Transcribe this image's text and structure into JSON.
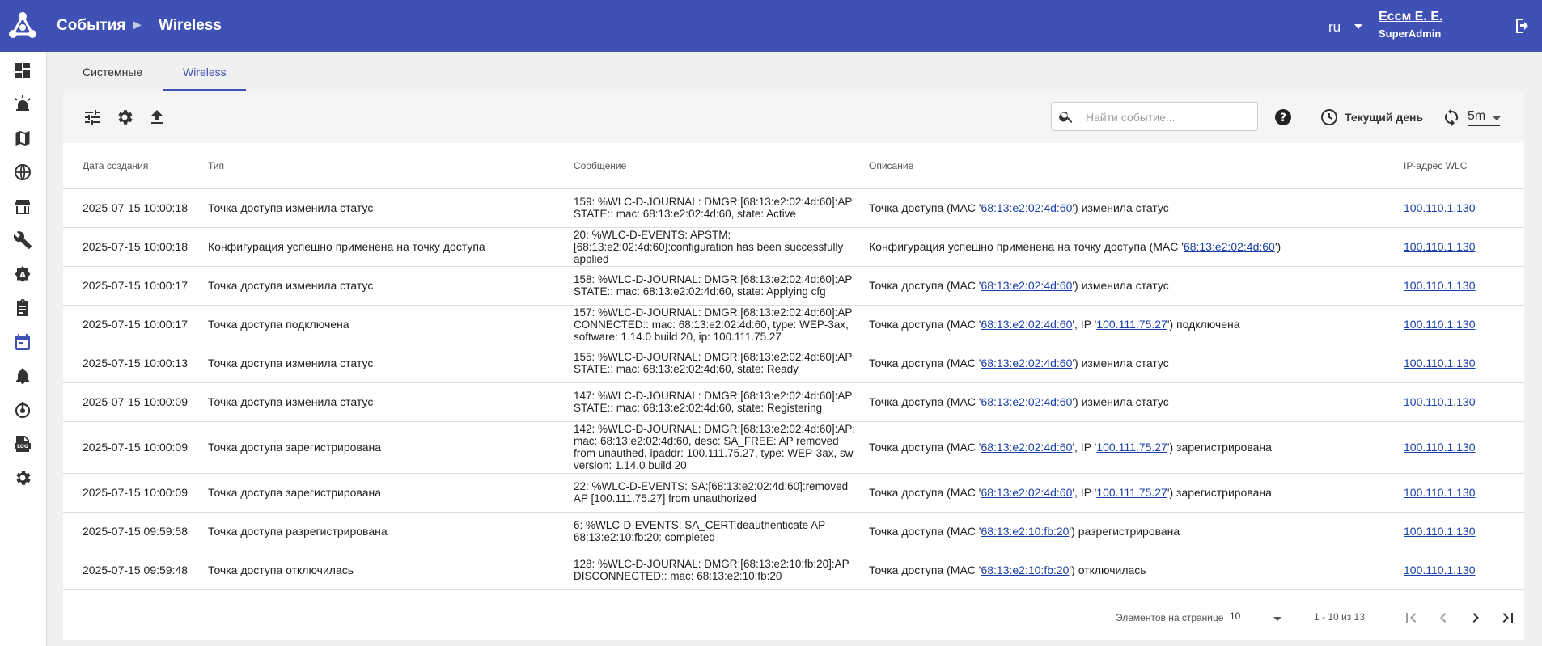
{
  "header": {
    "breadcrumb_root": "События",
    "breadcrumb_current": "Wireless",
    "language": "ru",
    "user_name": "Ессм Е. Е.",
    "user_role": "SuperAdmin"
  },
  "sidebar": {
    "items": [
      {
        "name": "dashboard",
        "icon": "dashboard-icon"
      },
      {
        "name": "alarms",
        "icon": "siren-icon"
      },
      {
        "name": "maps",
        "icon": "map-icon"
      },
      {
        "name": "network",
        "icon": "globe-icon"
      },
      {
        "name": "inventory",
        "icon": "store-icon"
      },
      {
        "name": "tools",
        "icon": "wrench-icon"
      },
      {
        "name": "auto-config",
        "icon": "gear-a-icon"
      },
      {
        "name": "tasks",
        "icon": "clipboard-icon"
      },
      {
        "name": "events",
        "icon": "calendar-icon",
        "active": true
      },
      {
        "name": "notifications",
        "icon": "bell-icon"
      },
      {
        "name": "monitoring",
        "icon": "power-icon"
      },
      {
        "name": "logs",
        "icon": "log-icon"
      },
      {
        "name": "settings",
        "icon": "settings-icon"
      }
    ]
  },
  "tabs": [
    {
      "label": "Системные",
      "active": false
    },
    {
      "label": "Wireless",
      "active": true
    }
  ],
  "toolbar": {
    "search_placeholder": "Найти событие...",
    "period": "Текущий день",
    "refresh_interval": "5m"
  },
  "table": {
    "columns": {
      "date": "Дата создания",
      "type": "Тип",
      "message": "Сообщение",
      "description": "Описание",
      "ip": "IP-адрес WLC"
    },
    "rows": [
      {
        "date": "2025-07-15 10:00:18",
        "type": "Точка доступа изменила статус",
        "message": "159: %WLC-D-JOURNAL: DMGR:[68:13:e2:02:4d:60]:AP STATE:: mac: 68:13:e2:02:4d:60, state: Active",
        "desc": {
          "pre": "Точка доступа (MAC '",
          "mac": "68:13:e2:02:4d:60",
          "mid": "",
          "ip": "",
          "post": "') изменила статус"
        },
        "ip": "100.110.1.130"
      },
      {
        "date": "2025-07-15 10:00:18",
        "type": "Конфигурация успешно применена на точку доступа",
        "message": "20: %WLC-D-EVENTS: APSTM: [68:13:e2:02:4d:60]:configuration has been successfully applied",
        "desc": {
          "pre": "Конфигурация успешно применена на точку доступа (MAC '",
          "mac": "68:13:e2:02:4d:60",
          "mid": "",
          "ip": "",
          "post": "')"
        },
        "ip": "100.110.1.130"
      },
      {
        "date": "2025-07-15 10:00:17",
        "type": "Точка доступа изменила статус",
        "message": "158: %WLC-D-JOURNAL: DMGR:[68:13:e2:02:4d:60]:AP STATE:: mac: 68:13:e2:02:4d:60, state: Applying cfg",
        "desc": {
          "pre": "Точка доступа (MAC '",
          "mac": "68:13:e2:02:4d:60",
          "mid": "",
          "ip": "",
          "post": "') изменила статус"
        },
        "ip": "100.110.1.130"
      },
      {
        "date": "2025-07-15 10:00:17",
        "type": "Точка доступа подключена",
        "message": "157: %WLC-D-JOURNAL: DMGR:[68:13:e2:02:4d:60]:AP CONNECTED:: mac: 68:13:e2:02:4d:60, type: WEP-3ax, software: 1.14.0 build 20, ip: 100.111.75.27",
        "desc": {
          "pre": "Точка доступа (MAC '",
          "mac": "68:13:e2:02:4d:60",
          "mid": "', IP '",
          "ip": "100.111.75.27",
          "post": "') подключена"
        },
        "ip": "100.110.1.130"
      },
      {
        "date": "2025-07-15 10:00:13",
        "type": "Точка доступа изменила статус",
        "message": "155: %WLC-D-JOURNAL: DMGR:[68:13:e2:02:4d:60]:AP STATE:: mac: 68:13:e2:02:4d:60, state: Ready",
        "desc": {
          "pre": "Точка доступа (MAC '",
          "mac": "68:13:e2:02:4d:60",
          "mid": "",
          "ip": "",
          "post": "') изменила статус"
        },
        "ip": "100.110.1.130"
      },
      {
        "date": "2025-07-15 10:00:09",
        "type": "Точка доступа изменила статус",
        "message": "147: %WLC-D-JOURNAL: DMGR:[68:13:e2:02:4d:60]:AP STATE:: mac: 68:13:e2:02:4d:60, state: Registering",
        "desc": {
          "pre": "Точка доступа (MAC '",
          "mac": "68:13:e2:02:4d:60",
          "mid": "",
          "ip": "",
          "post": "') изменила статус"
        },
        "ip": "100.110.1.130"
      },
      {
        "date": "2025-07-15 10:00:09",
        "type": "Точка доступа зарегистрирована",
        "message": "142: %WLC-D-JOURNAL: DMGR:[68:13:e2:02:4d:60]:AP: mac: 68:13:e2:02:4d:60, desc: SA_FREE: AP removed from unauthed, ipaddr: 100.111.75.27, type: WEP-3ax, sw version: 1.14.0 build 20",
        "desc": {
          "pre": "Точка доступа (MAC '",
          "mac": "68:13:e2:02:4d:60",
          "mid": "', IP '",
          "ip": "100.111.75.27",
          "post": "') зарегистрирована"
        },
        "ip": "100.110.1.130",
        "tall": true
      },
      {
        "date": "2025-07-15 10:00:09",
        "type": "Точка доступа зарегистрирована",
        "message": "22: %WLC-D-EVENTS: SA:[68:13:e2:02:4d:60]:removed AP [100.111.75.27] from unauthorized",
        "desc": {
          "pre": "Точка доступа (MAC '",
          "mac": "68:13:e2:02:4d:60",
          "mid": "', IP '",
          "ip": "100.111.75.27",
          "post": "') зарегистрирована"
        },
        "ip": "100.110.1.130"
      },
      {
        "date": "2025-07-15 09:59:58",
        "type": "Точка доступа разрегистрирована",
        "message": "6: %WLC-D-EVENTS: SA_CERT:deauthenticate AP 68:13:e2:10:fb:20: completed",
        "desc": {
          "pre": "Точка доступа (MAC '",
          "mac": "68:13:e2:10:fb:20",
          "mid": "",
          "ip": "",
          "post": "') разрегистрирована"
        },
        "ip": "100.110.1.130"
      },
      {
        "date": "2025-07-15 09:59:48",
        "type": "Точка доступа отключилась",
        "message": "128: %WLC-D-JOURNAL: DMGR:[68:13:e2:10:fb:20]:AP DISCONNECTED:: mac: 68:13:e2:10:fb:20",
        "desc": {
          "pre": "Точка доступа (MAC '",
          "mac": "68:13:e2:10:fb:20",
          "mid": "",
          "ip": "",
          "post": "') отключилась"
        },
        "ip": "100.110.1.130"
      }
    ]
  },
  "paginator": {
    "label": "Элементов на странице",
    "page_size": "10",
    "range": "1 - 10 из 13"
  },
  "colors": {
    "primary": "#3f51b5",
    "link": "#1a3fa8"
  }
}
